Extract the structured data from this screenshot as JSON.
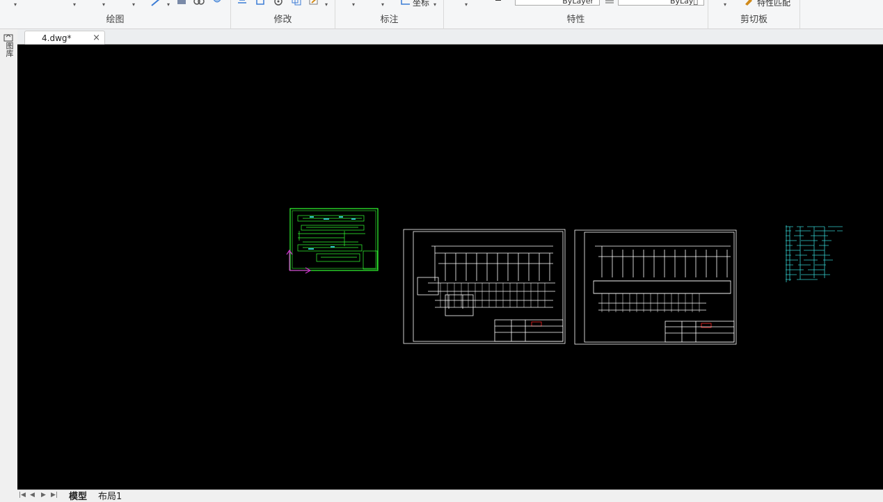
{
  "ribbon": {
    "groups": [
      {
        "label": "绘图"
      },
      {
        "label": "修改"
      },
      {
        "label": "标注"
      },
      {
        "label": "特性"
      },
      {
        "label": "剪切板"
      }
    ],
    "coord_button": "坐标",
    "layer_value_1": "ByLayer",
    "layer_value_2": "ByLay\u0000",
    "match_props": "特性匹配"
  },
  "left_dock": {
    "label": "图库"
  },
  "document_tab": {
    "label": "4.dwg*",
    "close": "×"
  },
  "layout_tabs": [
    {
      "label": "模型",
      "active": true
    },
    {
      "label": "布局1",
      "active": false
    }
  ],
  "nav_buttons": [
    "|◀",
    "◀",
    "▶",
    "▶|"
  ],
  "colors": {
    "canvas_bg": "#000000",
    "drawing_white": "#ffffff",
    "drawing_green": "#33ff33",
    "drawing_cyan": "#33cccc",
    "ucs_magenta": "#cc33cc",
    "title_red": "#ff2222"
  }
}
